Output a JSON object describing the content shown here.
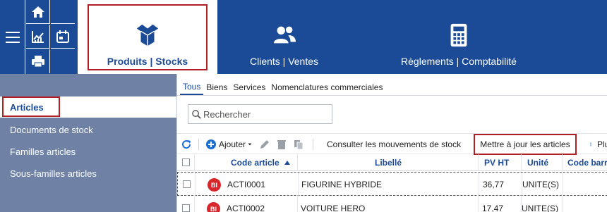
{
  "colors": {
    "brand": "#1b4a96",
    "highlight": "#b11f24",
    "sidebar": "#6f82a5",
    "badge": "#d9262c"
  },
  "topbar": {
    "quick_icons": [
      "hamburger-icon",
      "home-icon",
      "chart-icon",
      "calendar-icon",
      "printer-icon"
    ],
    "modules": [
      {
        "label": "Produits | Stocks",
        "icon": "open-box-icon",
        "active": true
      },
      {
        "label": "Clients | Ventes",
        "icon": "users-icon",
        "active": false
      },
      {
        "label": "Règlements | Comptabilité",
        "icon": "calculator-icon",
        "active": false
      }
    ]
  },
  "sidebar": {
    "items": [
      {
        "label": "Articles",
        "active": true
      },
      {
        "label": "Documents de stock"
      },
      {
        "label": "Familles articles"
      },
      {
        "label": "Sous-familles articles"
      }
    ]
  },
  "tabs": [
    {
      "label": "Tous",
      "active": true
    },
    {
      "label": "Biens"
    },
    {
      "label": "Services"
    },
    {
      "label": "Nomenclatures commerciales"
    }
  ],
  "search": {
    "placeholder": "Rechercher"
  },
  "toolbar": {
    "add_label": "Ajouter",
    "consult_label": "Consulter les mouvements de stock",
    "update_label": "Mettre à jour les articles",
    "more_label": "Plus"
  },
  "table": {
    "columns": [
      "Code article",
      "Libellé",
      "PV HT",
      "Unité",
      "Code barre"
    ],
    "sort": {
      "column": "Code article",
      "direction": "asc"
    },
    "rows": [
      {
        "badge": "BI",
        "code": "ACTI0001",
        "libelle": "FIGURINE HYBRIDE",
        "pv_ht": "36,77",
        "unite": "UNITE(S)"
      },
      {
        "badge": "BI",
        "code": "ACTI0002",
        "libelle": "VOITURE HERO",
        "pv_ht": "17,47",
        "unite": "UNITE(S)"
      }
    ]
  }
}
